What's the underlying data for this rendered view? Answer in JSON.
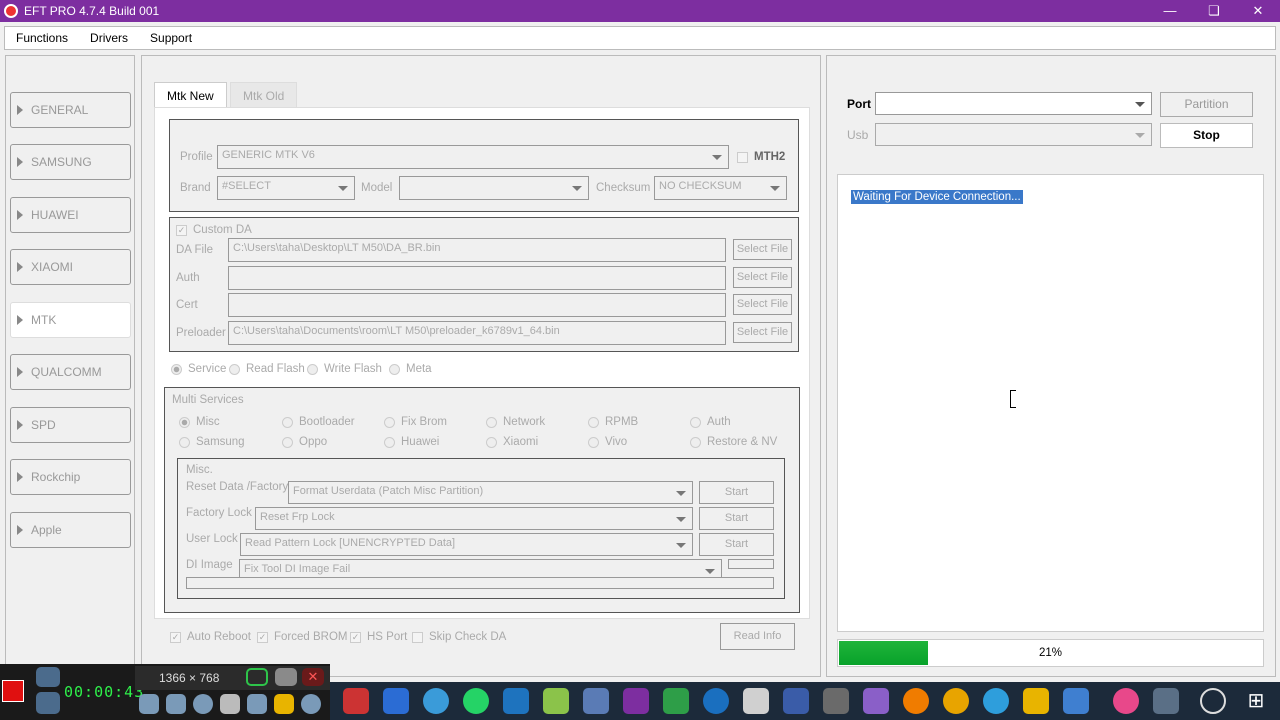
{
  "window": {
    "title": "EFT PRO 4.7.4 Build 001"
  },
  "menu": [
    "Functions",
    "Drivers",
    "Support"
  ],
  "sidebar": {
    "items": [
      {
        "label": "GENERAL"
      },
      {
        "label": "SAMSUNG"
      },
      {
        "label": "HUAWEI"
      },
      {
        "label": "XIAOMI"
      },
      {
        "label": "MTK"
      },
      {
        "label": "QUALCOMM"
      },
      {
        "label": "SPD"
      },
      {
        "label": "Rockchip"
      },
      {
        "label": "Apple"
      }
    ],
    "active": "MTK"
  },
  "tabs": {
    "active": "Mtk New",
    "inactive": "Mtk Old"
  },
  "profile": {
    "profile_label": "Profile",
    "profile_value": "GENERIC MTK V6",
    "mth2": "MTH2",
    "brand_label": "Brand",
    "brand_value": "#SELECT",
    "model_label": "Model",
    "model_value": "",
    "checksum_label": "Checksum",
    "checksum_value": "NO CHECKSUM"
  },
  "custom_da": {
    "label": "Custom DA",
    "rows": [
      {
        "label": "DA File",
        "value": "C:\\Users\\taha\\Desktop\\LT M50\\DA_BR.bin",
        "button": "Select File"
      },
      {
        "label": "Auth",
        "value": "",
        "button": "Select File"
      },
      {
        "label": "Cert",
        "value": "",
        "button": "Select File"
      },
      {
        "label": "Preloader",
        "value": "C:\\Users\\taha\\Documents\\room\\LT M50\\preloader_k6789v1_64.bin",
        "button": "Select File"
      }
    ]
  },
  "modes": [
    "Service",
    "Read Flash",
    "Write Flash",
    "Meta"
  ],
  "multi_services": {
    "title": "Multi Services",
    "row1": [
      "Misc",
      "Bootloader",
      "Fix Brom",
      "Network",
      "RPMB",
      "Auth"
    ],
    "row2": [
      "Samsung",
      "Oppo",
      "Huawei",
      "Xiaomi",
      "Vivo",
      "Restore & NV"
    ]
  },
  "misc": {
    "title": "Misc.",
    "rows": [
      {
        "label": "Reset Data /Factory",
        "value": "Format Userdata (Patch Misc Partition)",
        "button": "Start"
      },
      {
        "label": "Factory Lock",
        "value": "Reset Frp Lock",
        "button": "Start"
      },
      {
        "label": "User Lock",
        "value": "Read Pattern Lock [UNENCRYPTED Data]",
        "button": "Start"
      },
      {
        "label": "DI Image",
        "value": "Fix Tool DI Image Fail",
        "button": ""
      }
    ]
  },
  "bottom_options": [
    "Auto Reboot",
    "Forced BROM",
    "HS Port",
    "Skip Check DA"
  ],
  "read_info": "Read Info",
  "right": {
    "port_label": "Port",
    "usb_label": "Usb",
    "partition_btn": "Partition",
    "stop_btn": "Stop",
    "log_text": "Waiting For Device Connection...",
    "progress": 0.21,
    "progress_label": "21%"
  },
  "recorder": {
    "time": "00:00:43",
    "resolution": "1366 × 768"
  },
  "colors": {
    "titlebar": "#7d2ea0",
    "progress": "#1fb43a",
    "highlight": "#3a78c9"
  }
}
